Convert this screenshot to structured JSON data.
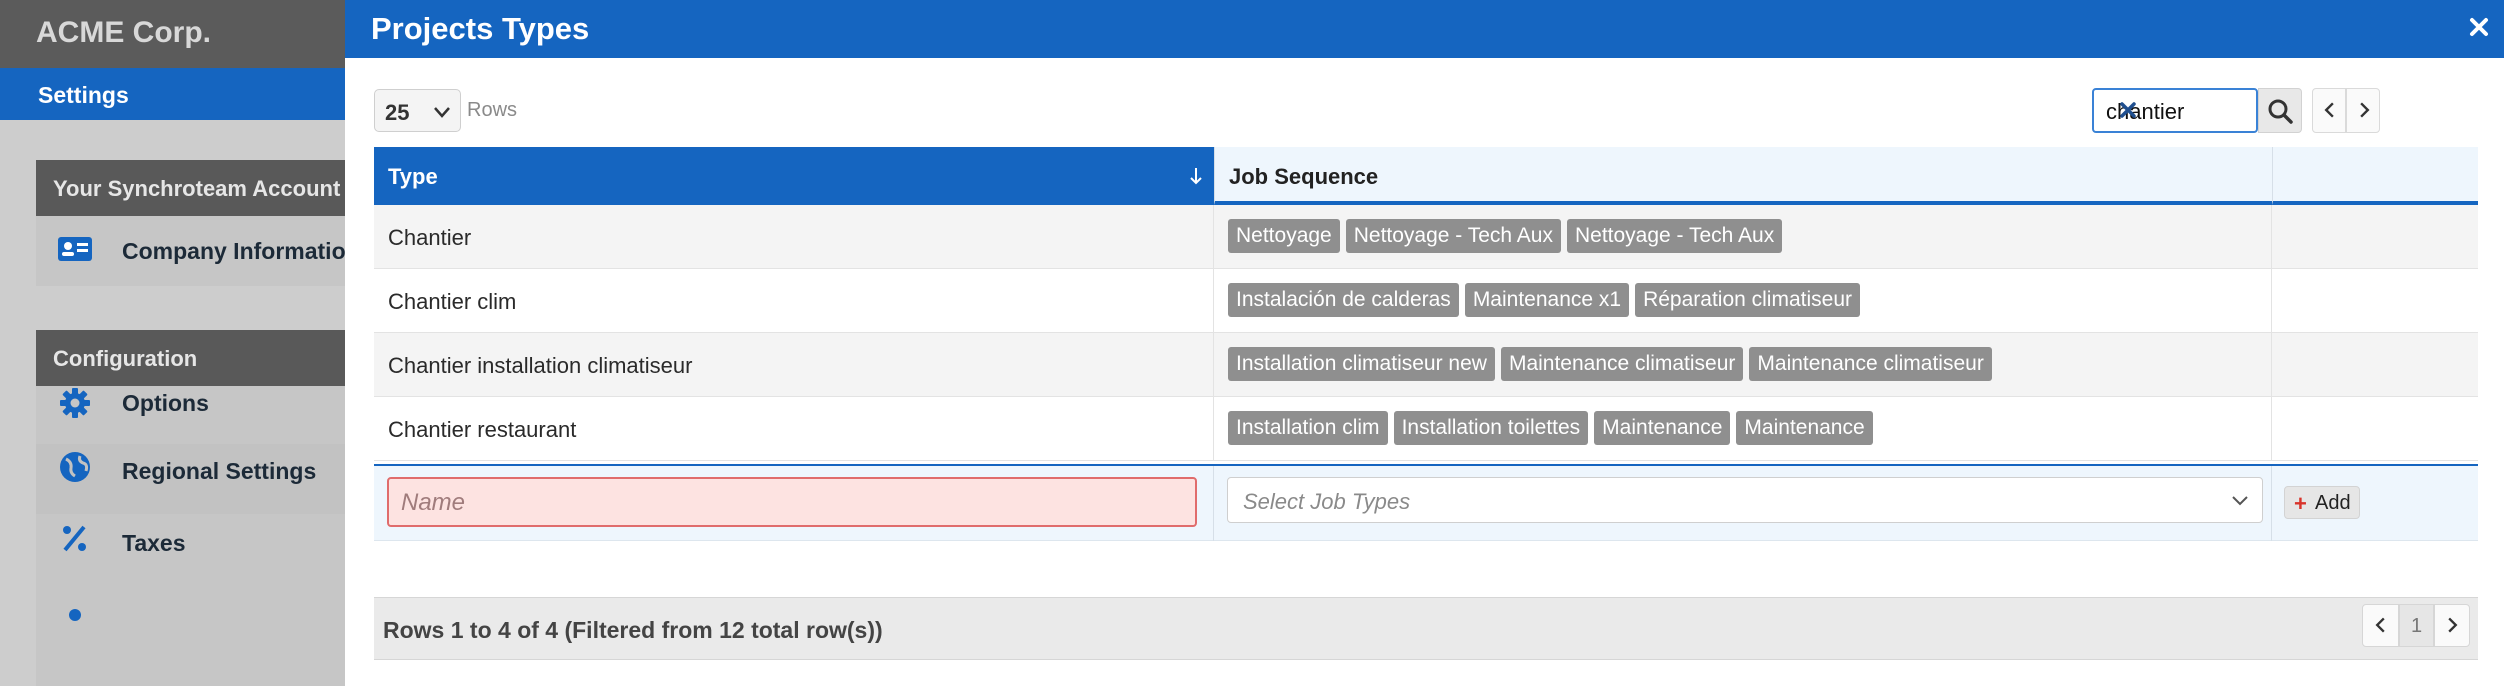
{
  "app": {
    "brand": "ACME Corp.",
    "section_title": "Settings"
  },
  "sidebar": {
    "groups": [
      {
        "header": "Your Synchroteam Account",
        "items": [
          {
            "label": "Company Information",
            "icon": "id-card-icon"
          }
        ]
      },
      {
        "header": "Configuration",
        "items": [
          {
            "label": "Options",
            "icon": "gear-icon"
          },
          {
            "label": "Regional Settings",
            "icon": "globe-icon"
          },
          {
            "label": "Taxes",
            "icon": "percent-icon"
          }
        ]
      }
    ]
  },
  "modal": {
    "title": "Projects Types",
    "rows_per_page": "25",
    "rows_label": "Rows",
    "search_value": "chantier",
    "columns": {
      "type": "Type",
      "job_sequence": "Job Sequence"
    },
    "rows": [
      {
        "type": "Chantier",
        "jobs": [
          "Nettoyage",
          "Nettoyage - Tech Aux",
          "Nettoyage - Tech Aux"
        ]
      },
      {
        "type": "Chantier clim",
        "jobs": [
          "Instalación de calderas",
          "Maintenance x1",
          "Réparation climatiseur"
        ]
      },
      {
        "type": "Chantier installation climatiseur",
        "jobs": [
          "Installation climatiseur new",
          "Maintenance climatiseur",
          "Maintenance climatiseur"
        ]
      },
      {
        "type": "Chantier restaurant",
        "jobs": [
          "Installation clim",
          "Installation toilettes",
          "Maintenance",
          "Maintenance"
        ]
      }
    ],
    "new_row": {
      "name_placeholder": "Name",
      "job_types_placeholder": "Select Job Types",
      "add_label": "Add"
    },
    "footer": {
      "info": "Rows 1 to 4 of 4 (Filtered from 12 total row(s))",
      "current_page": "1"
    }
  },
  "colors": {
    "primary": "#1565c0",
    "tag": "#8f8f8f",
    "error_bg": "#fde3e1",
    "error_border": "#e06c6c"
  }
}
